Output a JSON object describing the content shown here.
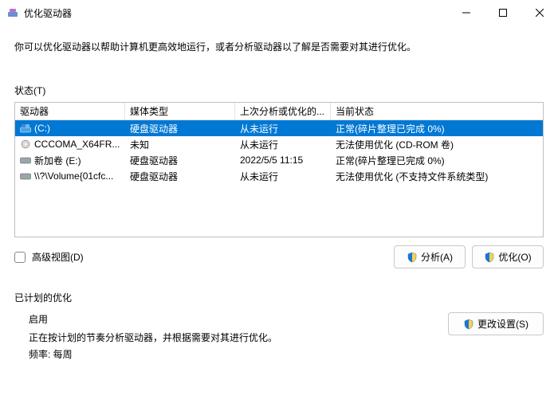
{
  "window": {
    "title": "优化驱动器"
  },
  "intro": "你可以优化驱动器以帮助计算机更高效地运行，或者分析驱动器以了解是否需要对其进行优化。",
  "status_label": "状态(T)",
  "columns": {
    "c0": "驱动器",
    "c1": "媒体类型",
    "c2": "上次分析或优化的...",
    "c3": "当前状态"
  },
  "rows": [
    {
      "name": "(C:)",
      "media": "硬盘驱动器",
      "last": "从未运行",
      "state": "正常(碎片整理已完成 0%)",
      "icon": "os",
      "selected": true
    },
    {
      "name": "CCCOMA_X64FR...",
      "media": "未知",
      "last": "从未运行",
      "state": "无法使用优化 (CD-ROM 卷)",
      "icon": "cd",
      "selected": false
    },
    {
      "name": "新加卷 (E:)",
      "media": "硬盘驱动器",
      "last": "2022/5/5 11:15",
      "state": "正常(碎片整理已完成 0%)",
      "icon": "hdd",
      "selected": false
    },
    {
      "name": "\\\\?\\Volume{01cfc...",
      "media": "硬盘驱动器",
      "last": "从未运行",
      "state": "无法使用优化 (不支持文件系统类型)",
      "icon": "hdd",
      "selected": false
    }
  ],
  "advanced_view": "高级视图(D)",
  "buttons": {
    "analyze": "分析(A)",
    "optimize": "优化(O)",
    "change": "更改设置(S)"
  },
  "schedule": {
    "title": "已计划的优化",
    "enabled": "启用",
    "desc": "正在按计划的节奏分析驱动器，并根据需要对其进行优化。",
    "freq": "频率: 每周"
  }
}
